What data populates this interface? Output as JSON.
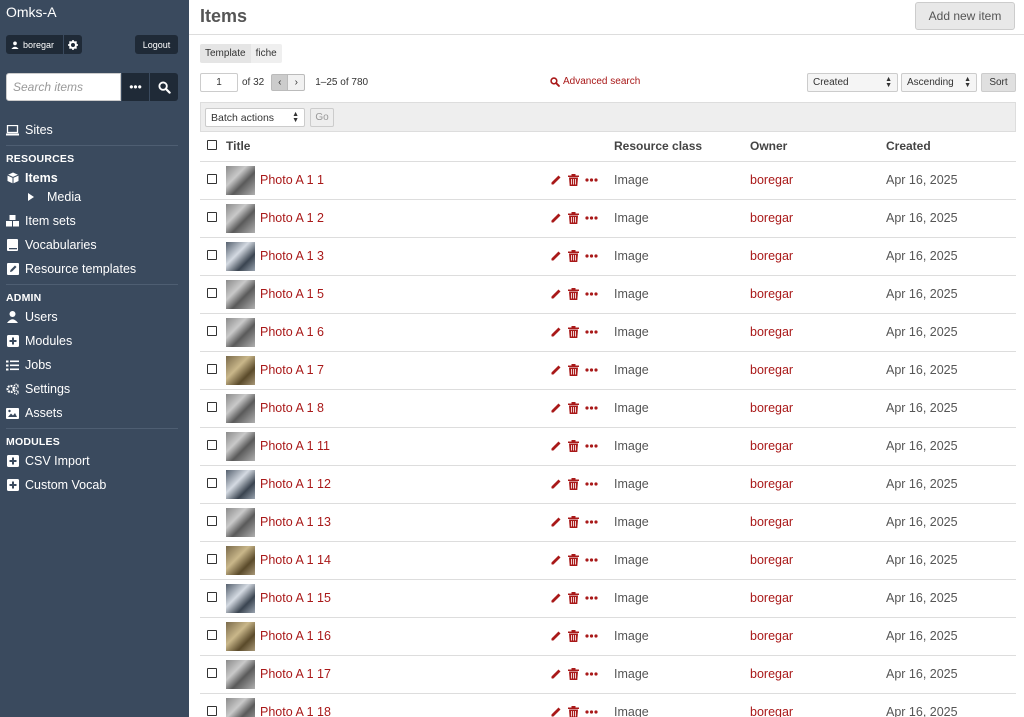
{
  "app": {
    "site_title": "Omks-A"
  },
  "user": {
    "name": "boregar",
    "logout_label": "Logout"
  },
  "search": {
    "placeholder": "Search items",
    "more_label": "•••"
  },
  "nav": {
    "sites": "Sites",
    "resources_heading": "RESOURCES",
    "items": "Items",
    "media": "Media",
    "item_sets": "Item sets",
    "vocabularies": "Vocabularies",
    "resource_templates": "Resource templates",
    "admin_heading": "ADMIN",
    "users": "Users",
    "modules": "Modules",
    "jobs": "Jobs",
    "settings": "Settings",
    "assets": "Assets",
    "modules_heading": "MODULES",
    "csv_import": "CSV Import",
    "custom_vocab": "Custom Vocab"
  },
  "header": {
    "title": "Items",
    "add_new_label": "Add new item"
  },
  "filter": {
    "key": "Template",
    "value": "fiche"
  },
  "pagination": {
    "current_page": "1",
    "of_label": "of 32",
    "range": "1–25 of 780"
  },
  "advanced_search_label": "Advanced search",
  "sort": {
    "by": "Created",
    "order": "Ascending",
    "button_label": "Sort"
  },
  "batch": {
    "select_label": "Batch actions",
    "go_label": "Go"
  },
  "table": {
    "headers": {
      "title": "Title",
      "resource_class": "Resource class",
      "owner": "Owner",
      "created": "Created"
    },
    "rows": [
      {
        "title": "Photo A 1 1",
        "resource_class": "Image",
        "owner": "boregar",
        "created": "Apr 16, 2025",
        "thumb": "bw"
      },
      {
        "title": "Photo A 1 2",
        "resource_class": "Image",
        "owner": "boregar",
        "created": "Apr 16, 2025",
        "thumb": "bw"
      },
      {
        "title": "Photo A 1 3",
        "resource_class": "Image",
        "owner": "boregar",
        "created": "Apr 16, 2025",
        "thumb": "blue"
      },
      {
        "title": "Photo A 1 5",
        "resource_class": "Image",
        "owner": "boregar",
        "created": "Apr 16, 2025",
        "thumb": "bw"
      },
      {
        "title": "Photo A 1 6",
        "resource_class": "Image",
        "owner": "boregar",
        "created": "Apr 16, 2025",
        "thumb": "bw"
      },
      {
        "title": "Photo A 1 7",
        "resource_class": "Image",
        "owner": "boregar",
        "created": "Apr 16, 2025",
        "thumb": "sepia"
      },
      {
        "title": "Photo A 1 8",
        "resource_class": "Image",
        "owner": "boregar",
        "created": "Apr 16, 2025",
        "thumb": "bw"
      },
      {
        "title": "Photo A 1 11",
        "resource_class": "Image",
        "owner": "boregar",
        "created": "Apr 16, 2025",
        "thumb": "bw"
      },
      {
        "title": "Photo A 1 12",
        "resource_class": "Image",
        "owner": "boregar",
        "created": "Apr 16, 2025",
        "thumb": "blue"
      },
      {
        "title": "Photo A 1 13",
        "resource_class": "Image",
        "owner": "boregar",
        "created": "Apr 16, 2025",
        "thumb": "bw"
      },
      {
        "title": "Photo A 1 14",
        "resource_class": "Image",
        "owner": "boregar",
        "created": "Apr 16, 2025",
        "thumb": "sepia"
      },
      {
        "title": "Photo A 1 15",
        "resource_class": "Image",
        "owner": "boregar",
        "created": "Apr 16, 2025",
        "thumb": "blue"
      },
      {
        "title": "Photo A 1 16",
        "resource_class": "Image",
        "owner": "boregar",
        "created": "Apr 16, 2025",
        "thumb": "sepia"
      },
      {
        "title": "Photo A 1 17",
        "resource_class": "Image",
        "owner": "boregar",
        "created": "Apr 16, 2025",
        "thumb": "bw"
      },
      {
        "title": "Photo A 1 18",
        "resource_class": "Image",
        "owner": "boregar",
        "created": "Apr 16, 2025",
        "thumb": "bw"
      }
    ]
  },
  "colors": {
    "sidebar_bg": "#3a4a5e",
    "link": "#a91919",
    "button_dark": "#1f2a37"
  }
}
